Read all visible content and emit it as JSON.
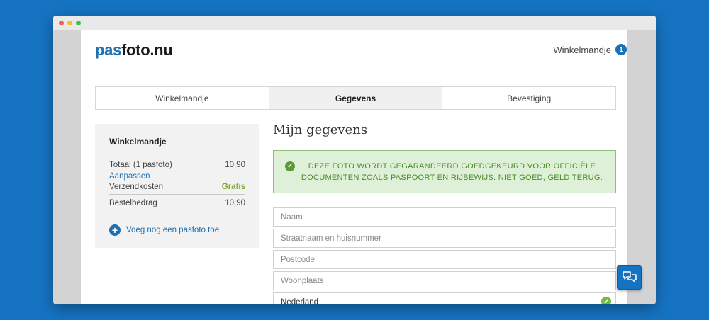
{
  "logo": {
    "part1": "pas",
    "part2": "foto.nu"
  },
  "header": {
    "cart_label": "Winkelmandje",
    "cart_count": "1"
  },
  "steps": [
    {
      "label": "Winkelmandje",
      "active": false
    },
    {
      "label": "Gegevens",
      "active": true
    },
    {
      "label": "Bevestiging",
      "active": false
    }
  ],
  "sidebar": {
    "title": "Winkelmandje",
    "total_label": "Totaal (1 pasfoto)",
    "total_value": "10,90",
    "edit_link": "Aanpassen",
    "shipping_label": "Verzendkosten",
    "shipping_value": "Gratis",
    "order_label": "Bestelbedrag",
    "order_value": "10,90",
    "add_label": "Voeg nog een pasfoto toe"
  },
  "main": {
    "title": "Mijn gegevens",
    "notice": "Deze foto wordt gegarandeerd goedgekeurd voor officiële documenten zoals paspoort en rijbewijs. Niet goed, geld terug."
  },
  "form": {
    "name_placeholder": "Naam",
    "street_placeholder": "Straatnaam en huisnummer",
    "postcode_placeholder": "Postcode",
    "city_placeholder": "Woonplaats",
    "country_value": "Nederland"
  },
  "colors": {
    "brand": "#1e6fb3",
    "background": "#1673c2",
    "success_bg": "#dff0d8",
    "success_text": "#4a8c2a",
    "free_green": "#7aaa2a"
  },
  "icons": {
    "notice": "check-circle-icon",
    "add": "plus-circle-icon",
    "valid": "check-circle-icon",
    "chat": "chat-bubbles-icon"
  }
}
